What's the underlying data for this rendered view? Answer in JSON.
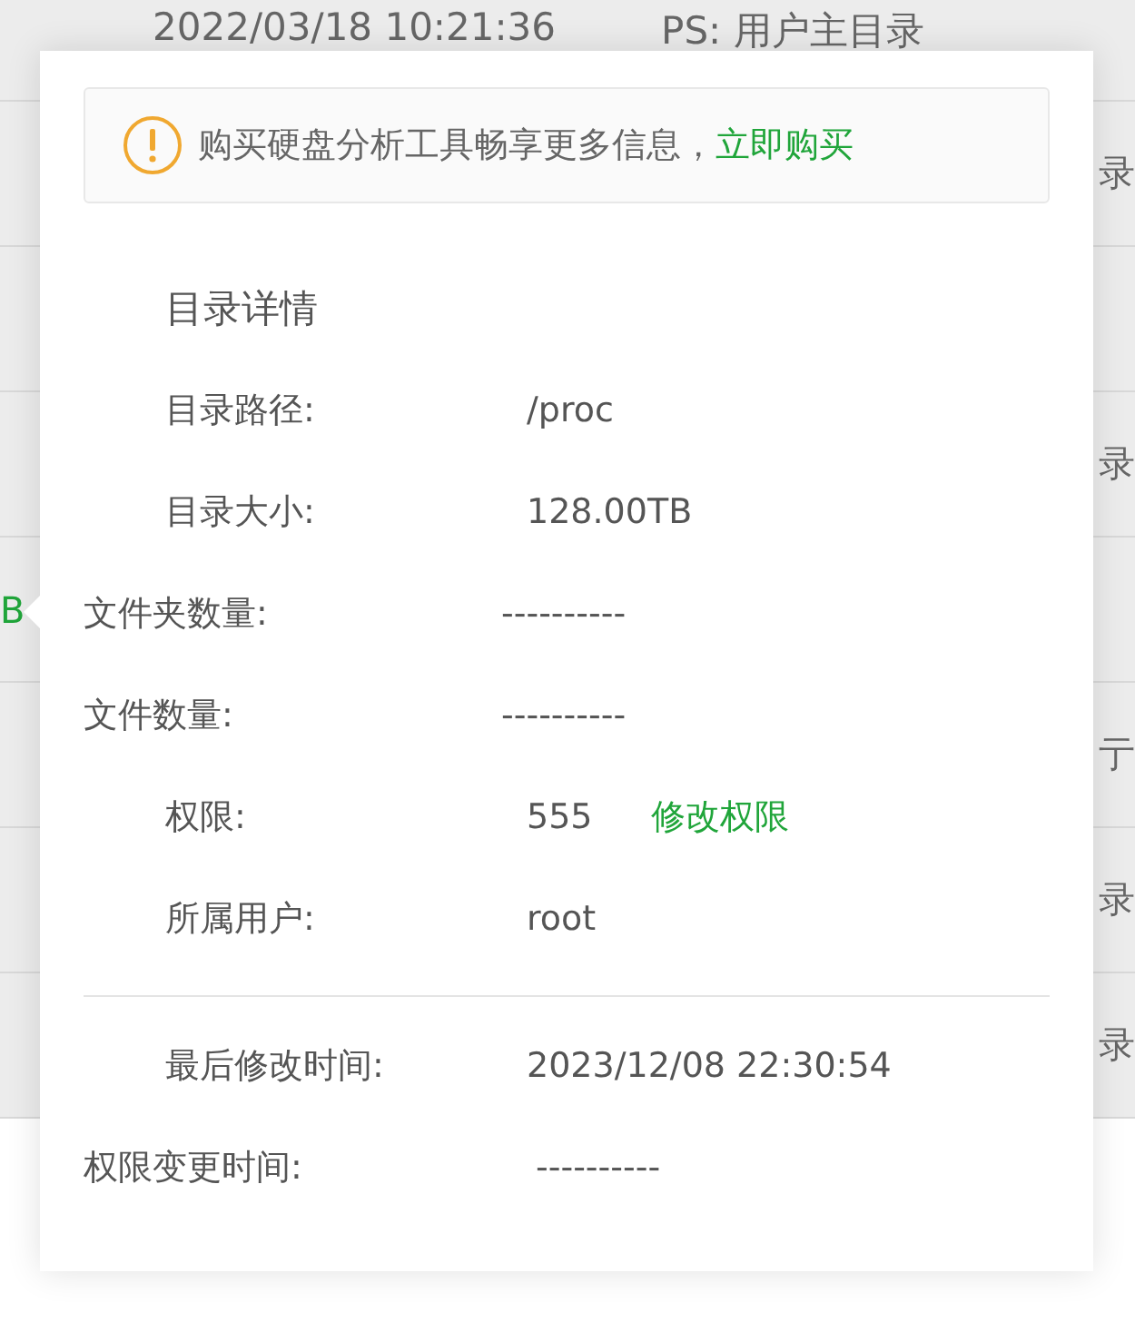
{
  "background_table": {
    "header": {
      "time": "2022/03/18 10:21:36",
      "note": "PS: 用户主目录"
    },
    "rows": [
      {
        "left": "",
        "right": "录"
      },
      {
        "left": "",
        "right": ""
      },
      {
        "left": "",
        "right": "录"
      },
      {
        "left": "B",
        "right": ""
      },
      {
        "left": "",
        "right": "亍"
      },
      {
        "left": "",
        "right": "录"
      },
      {
        "left": "",
        "right": "录"
      }
    ]
  },
  "popover": {
    "notice": {
      "text": "购买硬盘分析工具畅享更多信息，",
      "link": "立即购买"
    },
    "title": "目录详情",
    "details": [
      {
        "label": "目录路径:",
        "value": "/proc",
        "indented": true
      },
      {
        "label": "目录大小:",
        "value": "128.00TB",
        "indented": true
      },
      {
        "label": "文件夹数量:",
        "value": "----------",
        "indented": false
      },
      {
        "label": "文件数量:",
        "value": "----------",
        "indented": false
      },
      {
        "label": "权限:",
        "value": "555",
        "indented": true,
        "action": "修改权限"
      },
      {
        "label": "所属用户:",
        "value": "root",
        "indented": true
      }
    ],
    "times": [
      {
        "label": "最后修改时间:",
        "value": "2023/12/08 22:30:54",
        "indented": true
      },
      {
        "label": "权限变更时间:",
        "value": "----------",
        "indented": false
      }
    ]
  }
}
